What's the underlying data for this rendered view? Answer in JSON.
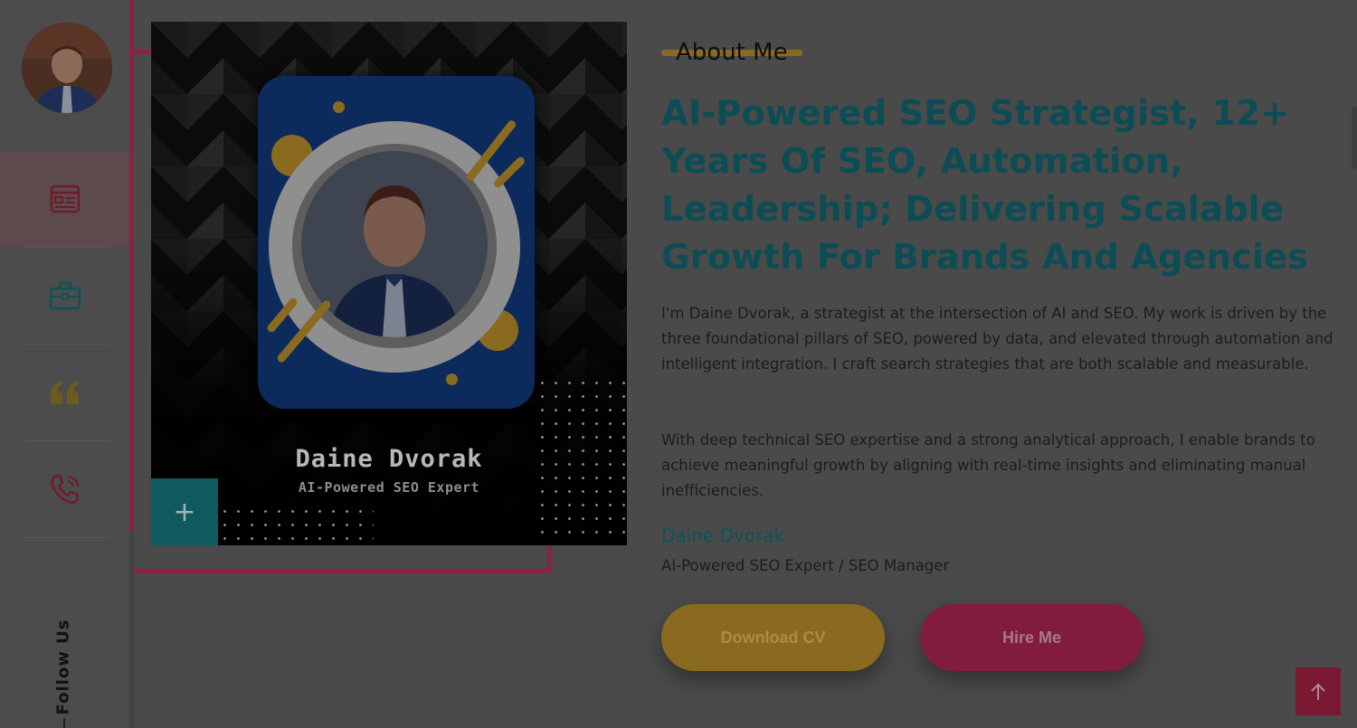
{
  "sidebar": {
    "nav": [
      {
        "icon": "resume-icon"
      },
      {
        "icon": "briefcase-icon"
      },
      {
        "icon": "quote-icon"
      },
      {
        "icon": "phone-icon"
      }
    ],
    "follow_label": "Follow Us"
  },
  "photo": {
    "name": "Daine Dvorak",
    "title": "AI-Powered SEO Expert",
    "plus": "+"
  },
  "about": {
    "heading": "About Me",
    "headline": "AI-Powered SEO Strategist, 12+ Years Of SEO, Automation, Leadership; Delivering Scalable Growth For Brands And Agencies",
    "paragraph_1": "I'm Daine Dvorak, a strategist at the intersection of AI and SEO. My work is driven by the three foundational pillars of SEO, powered by data, and elevated through automation and intelligent integration. I craft search strategies that are both scalable and measurable.",
    "paragraph_2": "With deep technical SEO expertise and a strong analytical approach, I enable brands to achieve meaningful growth by aligning with real-time insights and eliminating manual inefficiencies.",
    "signature_name": "Daine Dvorak",
    "signature_role": "AI-Powered SEO Expert / SEO Manager",
    "download_label": "Download CV",
    "hire_label": "Hire Me"
  },
  "colors": {
    "accent_teal": "#0c4d55",
    "accent_gold": "#8a6a1e",
    "accent_crimson": "#811c3c"
  }
}
